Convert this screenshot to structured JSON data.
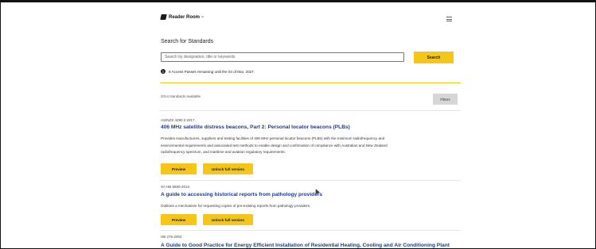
{
  "header": {
    "logo_text": "Reader Room",
    "logo_tm": "™",
    "logo_icon": "book-icon",
    "menu_icon": "hamburger-menu-icon"
  },
  "search": {
    "title": "Search for Standards",
    "placeholder": "Search by designation, title or keywords",
    "value": "",
    "button_label": "Search"
  },
  "access_note": {
    "icon": "info-icon",
    "icon_glyph": "i",
    "text": "8 Access Passes remaining until the 04 of Mar, 2027."
  },
  "results_bar": {
    "count_text": "2014 standards available",
    "filters_label": "Filters"
  },
  "colors": {
    "accent_yellow": "#f5c518",
    "title_blue": "#1f3b8a",
    "filters_grey": "#d6d6d6"
  },
  "results": [
    {
      "designation": "AS/NZS 4280.2:2017",
      "title": "406 MHz satellite distress beacons, Part 2: Personal locator beacons (PLBs)",
      "description_lines": [
        "Provides manufacturers, suppliers and testing facilities of 406 MHz personal locator beacons (PLBs) with the minimum radiofrequency and",
        "environmental requirements and associated test methods to enable design and confirmation of compliance with Australian and New Zealand",
        "radiofrequency spectrum, and maritime and aviation regulatory requirements."
      ],
      "preview_label": "Preview",
      "unlock_label": "Unlock full version"
    },
    {
      "designation": "SA HB 5550-2013",
      "title": "A guide to accessing historical reports from pathology providers",
      "description_lines": [
        "Outlines a mechanism for requesting copies of pre-existing reports from pathology providers."
      ],
      "preview_label": "Preview",
      "unlock_label": "Unlock full version"
    },
    {
      "designation": "HB 276-2004",
      "title": "A Guide to Good Practice for Energy Efficient Installation of Residential Heating, Cooling and Air Conditioning Plant"
    }
  ]
}
